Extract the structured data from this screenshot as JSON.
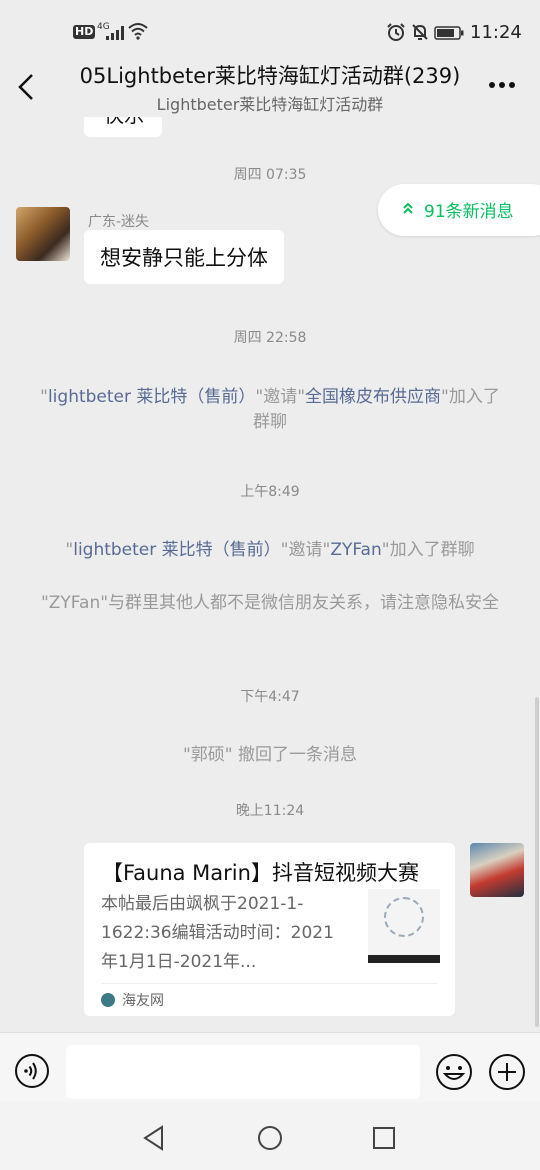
{
  "status_bar": {
    "hd": "HD",
    "network": "4G",
    "time": "11:24"
  },
  "header": {
    "title": "05Lightbeter莱比特海缸灯活动群(239)",
    "subtitle": "Lightbeter莱比特海缸灯活动群"
  },
  "new_messages": {
    "label": "91条新消息",
    "color": "#07c160"
  },
  "chat": {
    "clipped_bubble_text": "快乐",
    "ts1": "周四 07:35",
    "msg1": {
      "sender": "广东-迷失",
      "text": "想安静只能上分体"
    },
    "ts2": "周四 22:58",
    "sys1": {
      "q1": "\"",
      "inviter": "lightbeter 莱比特（售前）",
      "mid": "\"邀请\"",
      "invitee": "全国橡皮布供应商",
      "end": "\"加入了群聊"
    },
    "ts3": "上午8:49",
    "sys2": {
      "q1": "\"",
      "inviter": "lightbeter 莱比特（售前）",
      "mid": "\"邀请\"",
      "invitee": "ZYFan",
      "end": "\"加入了群聊"
    },
    "sys3": "\"ZYFan\"与群里其他人都不是微信朋友关系，请注意隐私安全",
    "ts4": "下午4:47",
    "sys4": "\"郭硕\" 撤回了一条消息",
    "ts5": "晚上11:24",
    "card": {
      "title": "【Fauna Marin】抖音短视频大赛",
      "desc": "本帖最后由飒枫于2021-1-1622:36编辑活动时间：2021年1月1日-2021年...",
      "source": "海友网"
    }
  },
  "colors": {
    "link": "#576b95",
    "background": "#ededed"
  }
}
